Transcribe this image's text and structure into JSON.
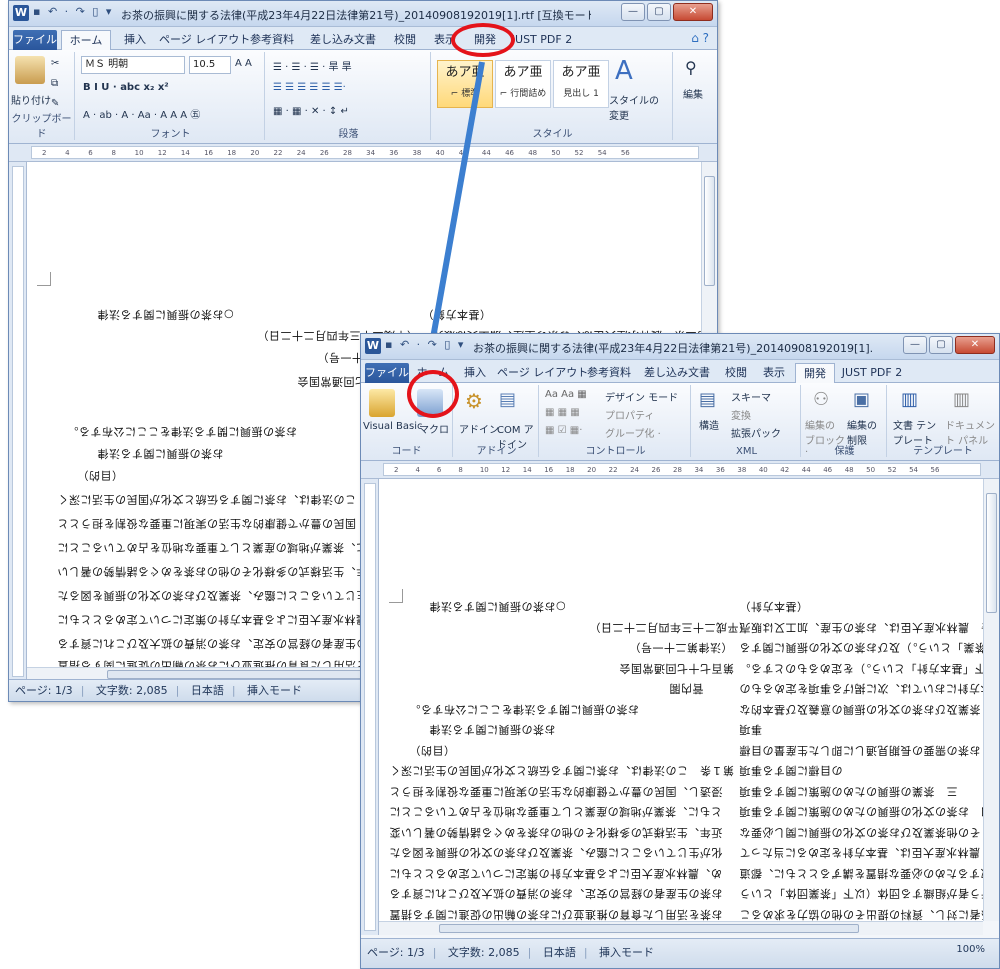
{
  "window1": {
    "app_icon": "W",
    "qat": "▪ ↶ · ↷ ▯ ▾",
    "title": "お茶の振興に関する法律(平成23年4月22日法律第21号)_20140908192019[1].rtf [互換モード] - Microsoft...",
    "min": "—",
    "max": "▢",
    "close": "✕",
    "tabs": [
      "ファイル",
      "ホーム",
      "挿入",
      "ページ レイアウト",
      "参考資料",
      "差し込み文書",
      "校閲",
      "表示",
      "開発",
      "JUST PDF 2"
    ],
    "help": "⌂ ?",
    "ribbon": {
      "paste_label": "貼り付け",
      "clipboard_label": "クリップボード",
      "font_name": "ＭＳ 明朝",
      "font_size": "10.5",
      "font_row2": "B  I  U · abc x₂ x²",
      "font_row3": "A · ab · A · Aa · A A  A ㊄",
      "font_label": "フォント",
      "para_row1": "☰ · ☰ · ☰ · 旱 旱",
      "para_row2": "☰ ☰ ☰ ☰ ☰ ☰·",
      "para_row3": "▦ · ▦ · ✕ · ↕ ↵",
      "para_label": "段落",
      "styles": [
        {
          "big": "あア亜",
          "sub": "⌐ 標準"
        },
        {
          "big": "あア亜",
          "sub": "⌐ 行間詰め"
        },
        {
          "big": "あア亜",
          "sub": "見出し 1"
        }
      ],
      "style_change": "スタイルの変更",
      "style_label": "スタイル",
      "edit_label": "編集"
    },
    "ruler_ticks": [
      "2",
      "4",
      "6",
      "8",
      "10",
      "12",
      "14",
      "16",
      "18",
      "20",
      "22",
      "24",
      "26",
      "28",
      "34",
      "36",
      "38",
      "40",
      "42",
      "44",
      "46",
      "48",
      "50",
      "52",
      "54",
      "56"
    ],
    "vruler_ticks": [
      "8",
      "6",
      "4",
      "2",
      "2",
      "4",
      "6",
      "8",
      "10",
      "12",
      "14",
      "16",
      "18",
      "20",
      "22",
      "24",
      "26",
      "28"
    ],
    "doc_lines": [
      "○お茶の振興に関する法律",
      "（平成二十三年四月二十二日）",
      "（法律第二十一号）",
      "第百七十七回通常国会",
      "お茶の振興に関する法律をここに公布する。",
      "お茶の振興に関する法律",
      "（目的）",
      "第１条　この法律は、お茶に関する伝統と文化が国民の生活に深く",
      "浸透し、国民の豊かで健康的な生活の実現に重要な役割を担うとと",
      "もに、茶業が地域の産業として重要な地位を占めていることに",
      "近年、生活様式の多様化その他のお茶をめぐる諸情勢の著しい",
      "化が生じていることに鑑み、茶業及びお茶の文化の振興を図るた",
      "め、農林水産大臣による基本方針の策定について定めるとともに",
      "お茶の生産者の経営の安定、お茶の消費の拡大及びこれに資する",
      "お茶を活用した食育の推進並びにお茶の輸出の促進に関する措置"
    ],
    "doc_right": [
      "（基本方針）",
      "第二条　農林水産大臣は、お茶の生産、加工又は販売"
    ],
    "status": [
      "ページ: 1/3",
      "文字数: 2,085",
      "日本語",
      "挿入モード"
    ]
  },
  "window2": {
    "app_icon": "W",
    "qat": "▪ ↶ · ↷ ▯ ▾",
    "title": "お茶の振興に関する法律(平成23年4月22日法律第21号)_20140908192019[1].rtf [互換モード] - Microsoft...",
    "min": "—",
    "max": "▢",
    "close": "✕",
    "tabs": [
      "ファイル",
      "ホーム",
      "挿入",
      "ページ レイアウト",
      "参考資料",
      "差し込み文書",
      "校閲",
      "表示",
      "開発",
      "JUST PDF 2"
    ],
    "ribbon": {
      "vb": "Visual Basic",
      "macro": "マクロ",
      "code_label": "コード",
      "addin": "アドイン",
      "com_addin": "COM アドイン",
      "addin_label": "アドイン",
      "design_mode": "デザイン モード",
      "property": "プロパティ",
      "group": "グループ化 ·",
      "control_label": "コントロール",
      "structure": "構造",
      "schema": "スキーマ",
      "transform": "変換",
      "expansion": "拡張パック",
      "xml_label": "XML",
      "block_authors": "編集の ブロック ·",
      "restrict_editing": "編集の 制限",
      "protect_label": "保護",
      "doc_template": "文書 テンプレート",
      "doc_panel": "ドキュメント パネル",
      "template_label": "テンプレート"
    },
    "doc_left": [
      "○お茶の振興に関する法律",
      "（平成二十三年四月二十二日）",
      "（法律第二十一号）",
      "第百七十七回通常国会",
      "菅内閣",
      "お茶の振興に関する法律をここに公布する。",
      "お茶の振興に関する法律",
      "（目的）",
      "第１条　この法律は、お茶に関する伝統と文化が国民の生活に深く",
      "浸透し、国民の豊かで健康的な生活の実現に重要な役割を担うと",
      "ともに、茶業が地域の産業として重要な地位を占めていることに",
      "近年、生活様式の多様化その他のお茶をめぐる諸情勢の著しい変",
      "化が生じていることに鑑み、茶業及びお茶の文化の振興を図るた",
      "め、農林水産大臣による基本方針の策定について定めるとともに",
      "お茶の生産者の経営の安定、お茶の消費の拡大及びこれに資する",
      "お茶を活用した食育の推進並びにお茶の輸出の促進に関する措置"
    ],
    "doc_right": [
      "（基本方針）",
      "第二条　農林水産大臣は、お茶の生産、加工又は販売",
      "「茶業」という。）及びお茶の文化の振興に関する",
      "下「基本方針」という。）を定めるものとする。",
      "２　基本方針においては、次に掲げる事項を定めるもの",
      "一　茶業及びお茶の文化の振興の意義及び基本的な",
      "事項",
      "二　お茶の需要の長期見通しに即した生産量の目標",
      "の目標に関する事項",
      "三　茶業の振興のための施策に関する事項",
      "四　お茶の文化の振興のための施策に関する事項",
      "五　その他茶業及びお茶の文化の振興に関し必要な",
      "３　農林水産大臣は、基本方針を定めるに当たって",
      "を聴取するための必要な措置を講ずるとともに、都道",
      "を行う者が組織する団体（以下「茶業団体」という",
      "関係者に対し、資料の提出その他の協力を求めるこ"
    ],
    "status": [
      "ページ: 1/3",
      "文字数: 2,085",
      "日本語",
      "挿入モード"
    ],
    "zoom": "100%"
  }
}
